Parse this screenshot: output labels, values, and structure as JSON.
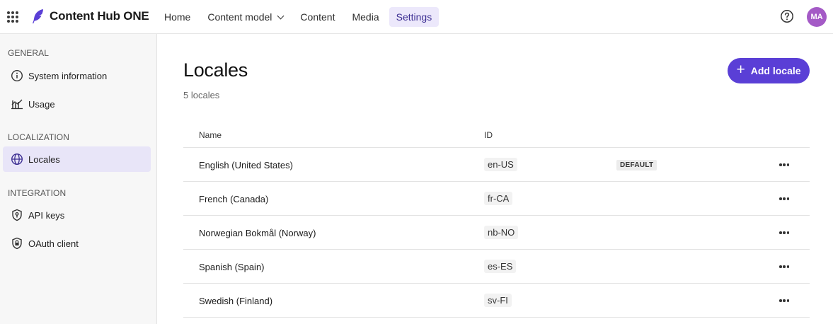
{
  "app": {
    "brand": "Content Hub ONE",
    "accent": "#5a3fd6",
    "avatar_initials": "MA",
    "avatar_color": "#a45ac6"
  },
  "nav": {
    "items": [
      {
        "label": "Home",
        "active": false
      },
      {
        "label": "Content model",
        "active": false,
        "has_dropdown": true
      },
      {
        "label": "Content",
        "active": false
      },
      {
        "label": "Media",
        "active": false
      },
      {
        "label": "Settings",
        "active": true
      }
    ]
  },
  "sidebar": {
    "groups": [
      {
        "title": "GENERAL",
        "items": [
          {
            "label": "System information",
            "icon": "info-icon"
          },
          {
            "label": "Usage",
            "icon": "usage-chart-icon"
          }
        ]
      },
      {
        "title": "LOCALIZATION",
        "items": [
          {
            "label": "Locales",
            "icon": "globe-icon",
            "active": true
          }
        ]
      },
      {
        "title": "INTEGRATION",
        "items": [
          {
            "label": "API keys",
            "icon": "key-shield-icon"
          },
          {
            "label": "OAuth client",
            "icon": "lock-shield-icon"
          }
        ]
      }
    ]
  },
  "main": {
    "title": "Locales",
    "subtitle": "5 locales",
    "add_button": "Add locale",
    "table": {
      "columns": [
        "Name",
        "ID"
      ],
      "rows": [
        {
          "name": "English (United States)",
          "id": "en-US",
          "badge": "DEFAULT"
        },
        {
          "name": "French (Canada)",
          "id": "fr-CA"
        },
        {
          "name": "Norwegian Bokmål (Norway)",
          "id": "nb-NO"
        },
        {
          "name": "Spanish (Spain)",
          "id": "es-ES"
        },
        {
          "name": "Swedish (Finland)",
          "id": "sv-FI"
        }
      ]
    }
  }
}
